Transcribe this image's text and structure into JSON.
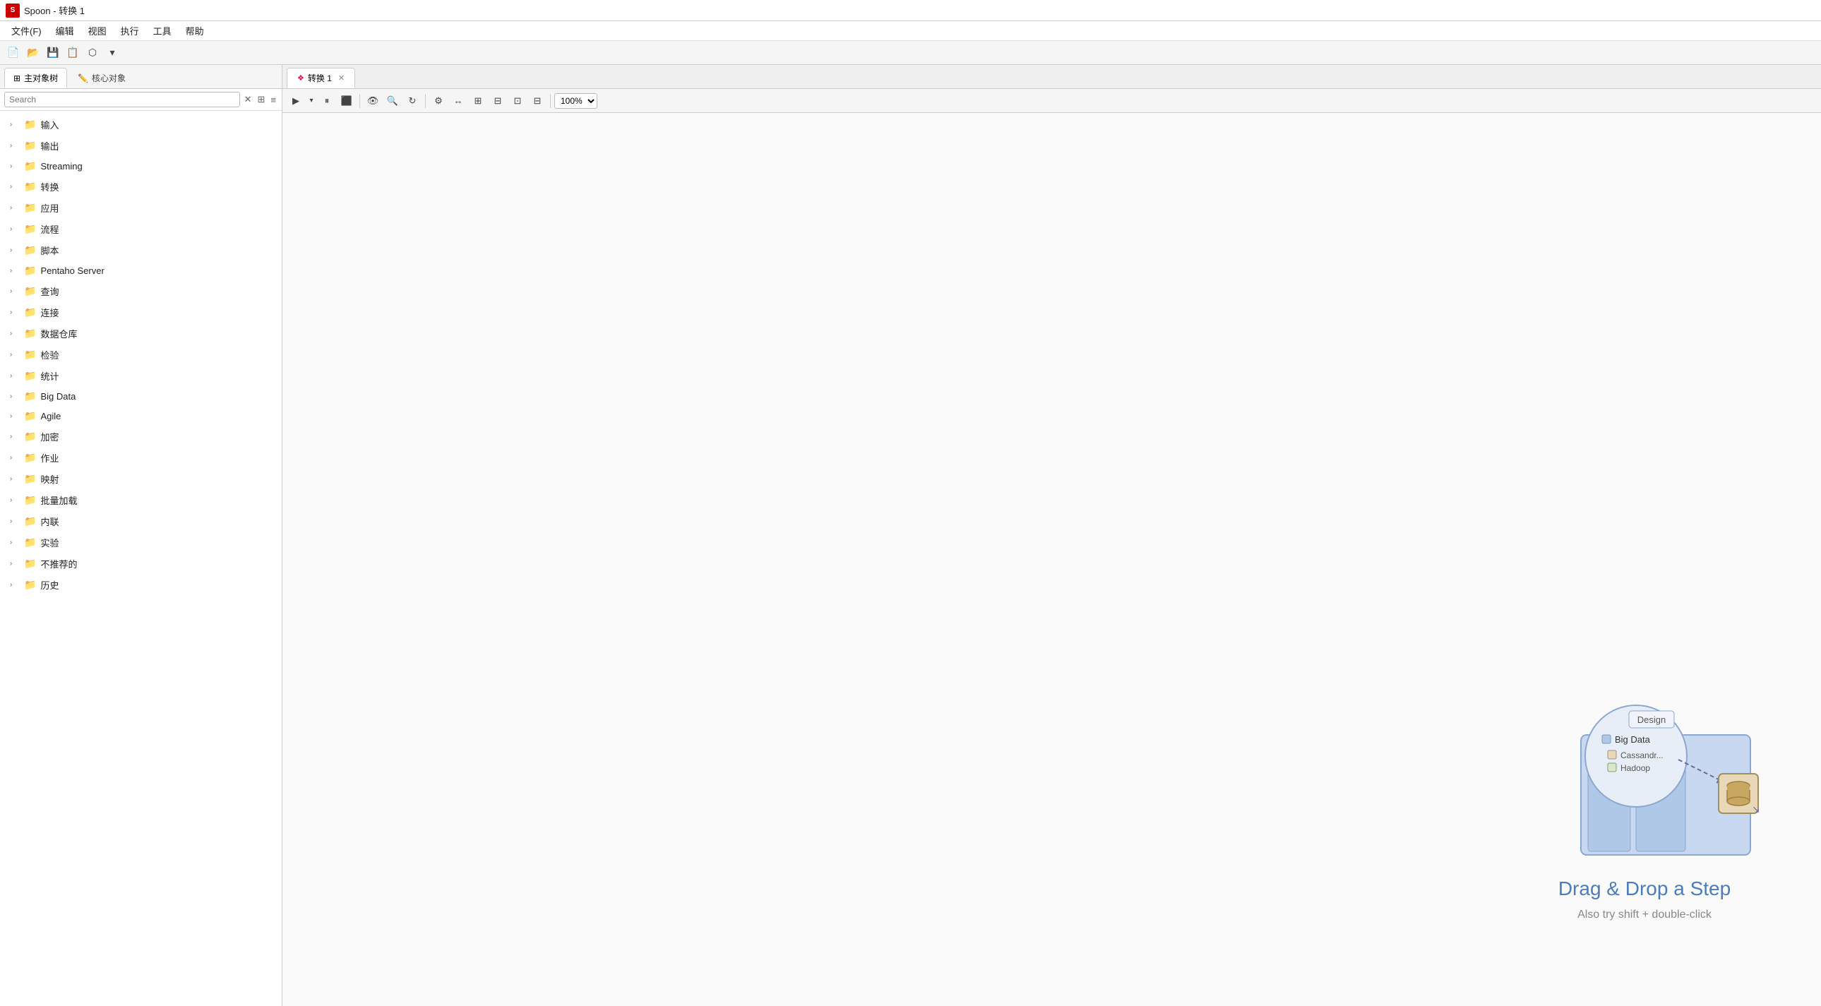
{
  "titleBar": {
    "appName": "Spoon",
    "separator": " - ",
    "documentName": "转换 1",
    "appIconLabel": "S"
  },
  "menuBar": {
    "items": [
      {
        "id": "file",
        "label": "文件(F)"
      },
      {
        "id": "edit",
        "label": "编辑"
      },
      {
        "id": "view",
        "label": "视图"
      },
      {
        "id": "run",
        "label": "执行"
      },
      {
        "id": "tools",
        "label": "工具"
      },
      {
        "id": "help",
        "label": "帮助"
      }
    ]
  },
  "toolbar": {
    "buttons": [
      {
        "id": "new",
        "icon": "📄",
        "title": "新建"
      },
      {
        "id": "open",
        "icon": "📂",
        "title": "打开"
      },
      {
        "id": "save",
        "icon": "💾",
        "title": "保存"
      },
      {
        "id": "saveas",
        "icon": "📋",
        "title": "另存为"
      },
      {
        "id": "layers",
        "icon": "⬡",
        "title": "层"
      },
      {
        "id": "dropdown",
        "icon": "▾",
        "title": ""
      }
    ]
  },
  "leftPanel": {
    "tabs": [
      {
        "id": "main-object-tree",
        "label": "主对象树",
        "icon": "⊞",
        "active": true
      },
      {
        "id": "core-object",
        "label": "核心对象",
        "icon": "✏️",
        "active": false
      }
    ],
    "search": {
      "placeholder": "Search",
      "clearButton": "✕",
      "layoutButtons": "⊞≡"
    },
    "treeItems": [
      {
        "id": "input",
        "label": "输入",
        "hasChildren": true
      },
      {
        "id": "output",
        "label": "输出",
        "hasChildren": true
      },
      {
        "id": "streaming",
        "label": "Streaming",
        "hasChildren": true
      },
      {
        "id": "transform",
        "label": "转换",
        "hasChildren": true
      },
      {
        "id": "app",
        "label": "应用",
        "hasChildren": true
      },
      {
        "id": "flow",
        "label": "流程",
        "hasChildren": true
      },
      {
        "id": "script",
        "label": "脚本",
        "hasChildren": true
      },
      {
        "id": "pentaho-server",
        "label": "Pentaho Server",
        "hasChildren": true
      },
      {
        "id": "query",
        "label": "查询",
        "hasChildren": true
      },
      {
        "id": "connect",
        "label": "连接",
        "hasChildren": true
      },
      {
        "id": "datawarehouse",
        "label": "数据仓库",
        "hasChildren": true
      },
      {
        "id": "validate",
        "label": "检验",
        "hasChildren": true
      },
      {
        "id": "stats",
        "label": "统计",
        "hasChildren": true
      },
      {
        "id": "bigdata",
        "label": "Big Data",
        "hasChildren": true
      },
      {
        "id": "agile",
        "label": "Agile",
        "hasChildren": true
      },
      {
        "id": "encrypt",
        "label": "加密",
        "hasChildren": true
      },
      {
        "id": "job",
        "label": "作业",
        "hasChildren": true
      },
      {
        "id": "mapping",
        "label": "映射",
        "hasChildren": true
      },
      {
        "id": "bulkload",
        "label": "批量加载",
        "hasChildren": true
      },
      {
        "id": "innerlink",
        "label": "内联",
        "hasChildren": true
      },
      {
        "id": "experiment",
        "label": "实验",
        "hasChildren": true
      },
      {
        "id": "deprecated",
        "label": "不推荐的",
        "hasChildren": true
      },
      {
        "id": "history",
        "label": "历史",
        "hasChildren": true
      }
    ]
  },
  "rightPanel": {
    "tabs": [
      {
        "id": "transform1",
        "label": "转换 1",
        "icon": "❖",
        "active": true,
        "closable": true
      }
    ],
    "toolbar": {
      "playBtn": "▶",
      "dropdownBtn": "▾",
      "pauseBtn": "⏸",
      "stopBtn": "⬛",
      "eyeBtn": "👁",
      "moreButtons": [
        "⟳",
        "▷",
        "◀",
        "▷",
        "⊞",
        "⊟",
        "⊡",
        "⊟"
      ],
      "zoom": "100%"
    },
    "canvas": {
      "dragDropTitle": "Drag & Drop a Step",
      "dragDropSubtitle": "Also try shift + double-click",
      "illustration": {
        "panelColor": "#c8d8f0",
        "circleColor": "#e8eef8",
        "bigDataLabel": "Big Data",
        "cassandraLabel": "Cassandra",
        "hadoopLabel": "Hadoop",
        "dbIconColor": "#8a7a50",
        "arrowColor": "#6a6a9a",
        "designLabel": "Design"
      }
    }
  }
}
